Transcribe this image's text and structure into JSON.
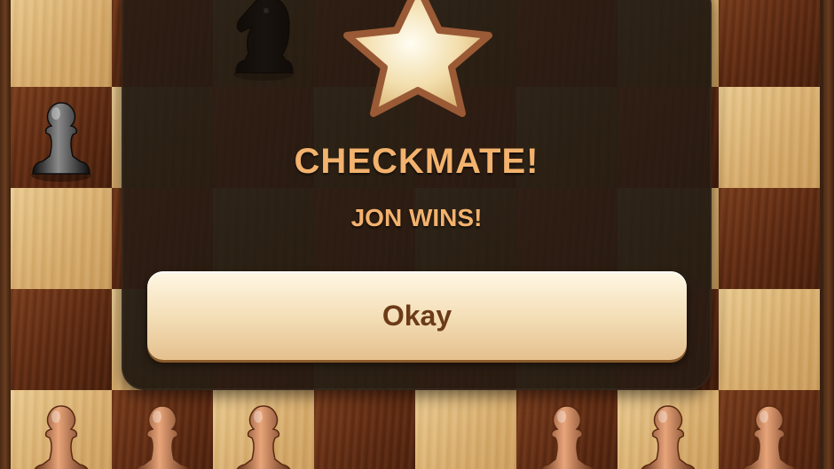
{
  "dialog": {
    "title": "CHECKMATE!",
    "subtitle": "JON WINS!",
    "button_label": "Okay",
    "icon": "star-icon"
  },
  "colors": {
    "light_square": "#d5a866",
    "dark_square": "#5e2a12",
    "title_text": "#f3b26d",
    "button_text": "#6b3b17",
    "black_piece": "#2a2a2a",
    "white_piece": "#a5623a"
  },
  "pieces": {
    "visible_black_pawns": 1,
    "visible_black_knights": 1,
    "visible_brown_pawns": 6
  }
}
